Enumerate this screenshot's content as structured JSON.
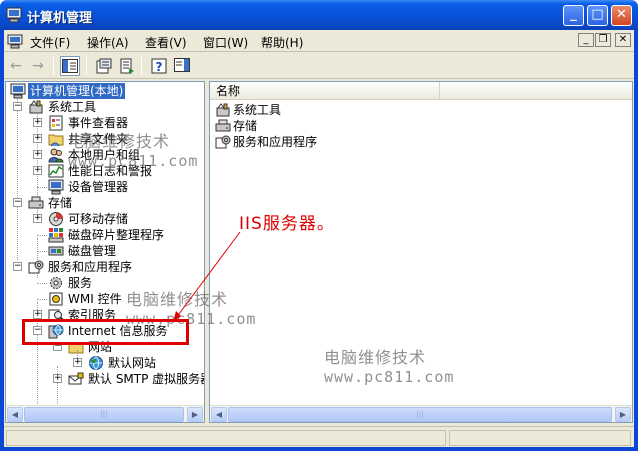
{
  "window": {
    "title": "计算机管理",
    "buttons": {
      "minimize": "_",
      "maximize": "□",
      "close": "✕"
    }
  },
  "menu": {
    "items": [
      "文件(F)",
      "操作(A)",
      "查看(V)",
      "窗口(W)",
      "帮助(H)"
    ],
    "mdi": {
      "minimize": "_",
      "restore": "❐",
      "close": "✕"
    }
  },
  "toolbar": {
    "back": "←",
    "forward": "→"
  },
  "tree": {
    "root": "计算机管理(本地)",
    "system_tools": "系统工具",
    "event_viewer": "事件查看器",
    "shared_folders": "共享文件夹",
    "local_users": "本地用户和组",
    "perf_logs": "性能日志和警报",
    "device_manager": "设备管理器",
    "storage": "存储",
    "removable": "可移动存储",
    "defrag": "磁盘碎片整理程序",
    "disk_mgmt": "磁盘管理",
    "services_apps": "服务和应用程序",
    "services": "服务",
    "wmi": "WMI 控件",
    "indexing": "索引服务",
    "iis": "Internet 信息服务",
    "websites": "网站",
    "default_site": "默认网站",
    "smtp": "默认 SMTP 虚拟服务器"
  },
  "list": {
    "column_name": "名称",
    "items": [
      "系统工具",
      "存储",
      "服务和应用程序"
    ]
  },
  "scroll": {
    "left": "◀",
    "right": "▶",
    "thumb": "|||"
  },
  "annotation": "IIS服务器。",
  "watermark": {
    "line1": "电脑维修技术",
    "line2": "www.pc811.com"
  }
}
